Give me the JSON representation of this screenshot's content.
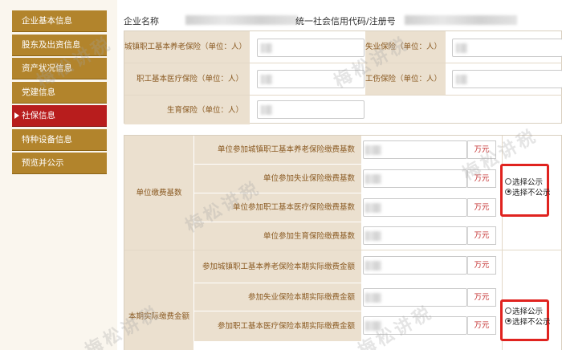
{
  "sidebar": {
    "items": [
      {
        "label": "企业基本信息"
      },
      {
        "label": "股东及出资信息"
      },
      {
        "label": "资产状况信息"
      },
      {
        "label": "党建信息"
      },
      {
        "label": "社保信息",
        "active": true
      },
      {
        "label": "特种设备信息"
      },
      {
        "label": "预览并公示"
      }
    ]
  },
  "header": {
    "company_name_label": "企业名称",
    "credit_code_label": "统一社会信用代码/注册号"
  },
  "insured_counts": {
    "urban_pension": "城镇职工基本养老保险（单位：人）",
    "unemployment": "失业保险（单位：人）",
    "medical": "职工基本医疗保险（单位：人）",
    "work_injury": "工伤保险（单位：人）",
    "maternity": "生育保险（单位：人）"
  },
  "contribution_base": {
    "group_label": "单位缴费基数",
    "rows": [
      {
        "label": "单位参加城镇职工基本养老保险缴费基数",
        "unit": "万元"
      },
      {
        "label": "单位参加失业保险缴费基数",
        "unit": "万元"
      },
      {
        "label": "单位参加职工基本医疗保险缴费基数",
        "unit": "万元"
      },
      {
        "label": "单位参加生育保险缴费基数",
        "unit": "万元"
      }
    ],
    "options": {
      "publish": "选择公示",
      "not_publish": "选择不公示"
    }
  },
  "actual_payment": {
    "group_label": "本期实际缴费金额",
    "rows": [
      {
        "label": "参加城镇职工基本养老保险本期实际缴费金额",
        "unit": "万元"
      },
      {
        "label": "参加失业保险本期实际缴费金额",
        "unit": "万元"
      },
      {
        "label": "参加职工基本医疗保险本期实际缴费金额",
        "unit": "万元"
      }
    ],
    "options": {
      "publish": "选择公示",
      "not_publish": "选择不公示"
    }
  },
  "watermark": {
    "text": "梅松讲税"
  }
}
